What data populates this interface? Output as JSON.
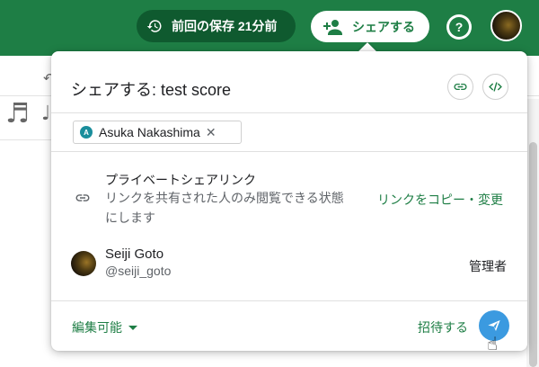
{
  "topbar": {
    "save_status": "前回の保存 21分前",
    "share_label": "シェアする",
    "help_label": "?",
    "icons": {
      "history": "history-icon",
      "add_person": "person-add-icon",
      "help": "help-icon"
    }
  },
  "background": {
    "notes": [
      "♬",
      "♩"
    ]
  },
  "dialog": {
    "title": "シェアする: test score",
    "chip": {
      "initial": "A",
      "name": "Asuka Nakashima",
      "remove": "✕"
    },
    "private_link": {
      "title": "プライベートシェアリンク",
      "description": "リンクを共有された人のみ閲覧できる状態にします",
      "action": "リンクをコピー・変更"
    },
    "member": {
      "name": "Seiji Goto",
      "handle": "@seiji_goto",
      "role": "管理者"
    },
    "footer": {
      "permission": "編集可能",
      "invite": "招待する"
    }
  },
  "colors": {
    "brand": "#1e7e45",
    "brand_dark": "#0f5a2f",
    "send": "#3b9ae0",
    "chip_avatar": "#1a8e9c"
  }
}
